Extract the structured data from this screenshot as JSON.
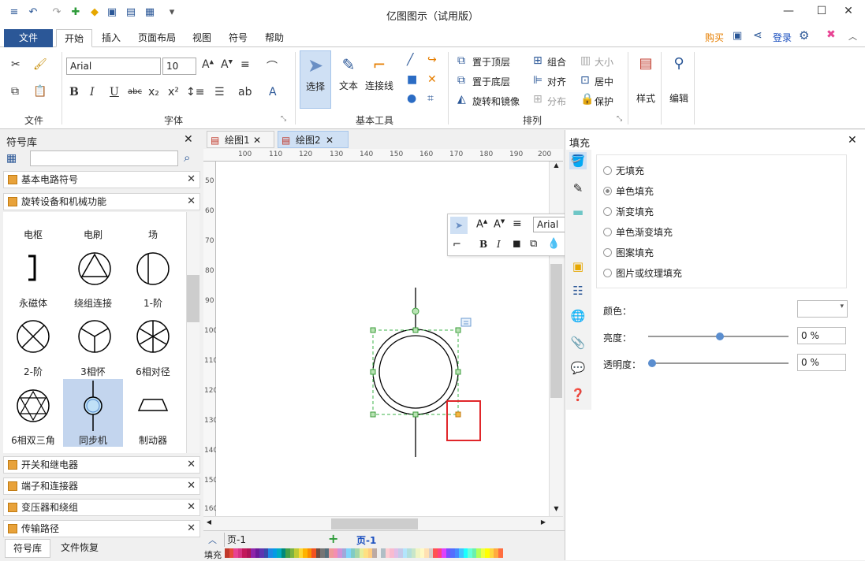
{
  "window": {
    "title": "亿图图示（试用版）",
    "minimize": "—",
    "maximize": "☐",
    "close": "✕"
  },
  "quick_access": [
    "≡",
    "↶",
    "↷",
    "✚",
    "◆",
    "▣",
    "▤",
    "▦",
    "▾"
  ],
  "menu": {
    "file": "文件",
    "tabs": [
      "开始",
      "插入",
      "页面布局",
      "视图",
      "符号",
      "帮助"
    ],
    "right": {
      "buy": "购买",
      "login": "登录"
    }
  },
  "ribbon": {
    "groups": {
      "file": "文件",
      "font": "字体",
      "basic_tools": "基本工具",
      "arrange": "排列"
    },
    "font_name": "Arial",
    "font_size": "10",
    "tools": {
      "select": "选择",
      "text": "文本",
      "connector": "连接线"
    },
    "arrange": {
      "bring_front": "置于顶层",
      "send_back": "置于底层",
      "rotate_mirror": "旋转和镜像",
      "group": "组合",
      "align": "对齐",
      "distribute": "分布",
      "size": "大小",
      "center": "居中",
      "protect": "保护"
    },
    "style": "样式",
    "edit": "编辑"
  },
  "library": {
    "title": "符号库",
    "search_placeholder": "",
    "top_categories": [
      "基本电路符号",
      "旋转设备和机械功能"
    ],
    "symbols": [
      {
        "name": "电枢",
        "icon": "armature-icon"
      },
      {
        "name": "电刷",
        "icon": "brush-icon"
      },
      {
        "name": "场",
        "icon": "field-icon"
      },
      {
        "name": "永磁体",
        "icon": "permanent-magnet-icon"
      },
      {
        "name": "绕组连接",
        "icon": "winding-connection-icon"
      },
      {
        "name": "1-阶",
        "icon": "phase1-icon"
      },
      {
        "name": "2-阶",
        "icon": "phase2-icon"
      },
      {
        "name": "3相怀",
        "icon": "phase3-icon"
      },
      {
        "name": "6相对径",
        "icon": "phase6-diametric-icon"
      },
      {
        "name": "6相双三角",
        "icon": "phase6-double-delta-icon"
      },
      {
        "name": "同步机",
        "icon": "synchronous-machine-icon"
      },
      {
        "name": "制动器",
        "icon": "brake-icon"
      }
    ],
    "bottom_categories": [
      "开关和继电器",
      "端子和连接器",
      "变压器和绕组",
      "传输路径"
    ],
    "footer_tabs": [
      "符号库",
      "文件恢复"
    ]
  },
  "canvas": {
    "tabs": [
      "绘图1",
      "绘图2"
    ],
    "active_tab": "绘图2",
    "ruler_h": [
      "100",
      "110",
      "120",
      "130",
      "140",
      "150",
      "160",
      "170",
      "180",
      "190",
      "200"
    ],
    "ruler_v": [
      "50",
      "60",
      "70",
      "80",
      "90",
      "100",
      "110",
      "120",
      "130",
      "140",
      "150",
      "160"
    ],
    "mini_toolbar_font": "Arial",
    "page_selector": "页-1",
    "page_tab": "页-1",
    "fill_label": "填充"
  },
  "fill_panel": {
    "title": "填充",
    "options": [
      "无填充",
      "单色填充",
      "渐变填充",
      "单色渐变填充",
      "图案填充",
      "图片或纹理填充"
    ],
    "selected_option": "单色填充",
    "color_label": "颜色：",
    "brightness_label": "亮度：",
    "brightness_value": "0 %",
    "transparency_label": "透明度：",
    "transparency_value": "0 %"
  },
  "palette": [
    "#c0392b",
    "#e74c3c",
    "#e84393",
    "#d63384",
    "#c2185b",
    "#ad1457",
    "#8e24aa",
    "#6a1b9a",
    "#5e35b1",
    "#3949ab",
    "#1e88e5",
    "#039be5",
    "#00acc1",
    "#00897b",
    "#43a047",
    "#7cb342",
    "#c0ca33",
    "#fdd835",
    "#ffb300",
    "#fb8c00",
    "#f4511e",
    "#6d4c41",
    "#757575",
    "#546e7a",
    "#ef9a9a",
    "#f48fb1",
    "#ce93d8",
    "#9fa8da",
    "#81d4fa",
    "#80cbc4",
    "#a5d6a7",
    "#e6ee9c",
    "#ffe082",
    "#ffcc80",
    "#bcaaa4",
    "#eeeeee",
    "#b0bec5",
    "#ffcdd2",
    "#f8bbd0",
    "#e1bee7",
    "#c5cae9",
    "#b3e5fc",
    "#b2dfdb",
    "#c8e6c9",
    "#f0f4c3",
    "#fff9c4",
    "#ffe0b2",
    "#d7ccc8",
    "#ff5252",
    "#ff4081",
    "#e040fb",
    "#7c4dff",
    "#536dfe",
    "#448aff",
    "#40c4ff",
    "#18ffff",
    "#64ffda",
    "#69f0ae",
    "#b2ff59",
    "#eeff41",
    "#ffff00",
    "#ffd740",
    "#ffab40",
    "#ff6e40"
  ]
}
